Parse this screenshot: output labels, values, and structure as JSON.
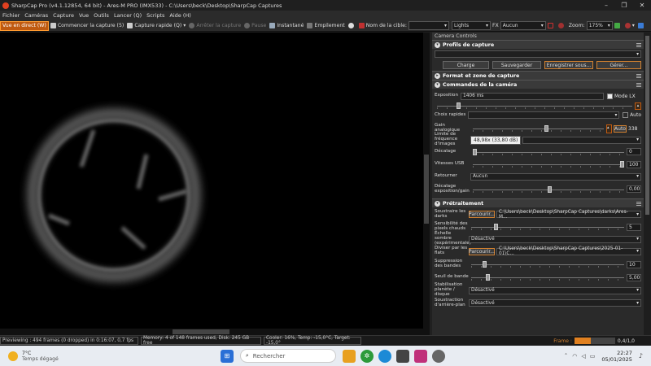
{
  "window": {
    "title": "SharpCap Pro (v4.1.12854, 64 bit) - Ares-M PRO (IMX533) - C:\\Users\\beck\\Desktop\\SharpCap Captures"
  },
  "menu": [
    "Fichier",
    "Caméras",
    "Capture",
    "Vue",
    "Outils",
    "Lancer (Q)",
    "Scripts",
    "Aide (H)"
  ],
  "toolbar": {
    "live": "Vue en direct (W)",
    "start": "Commencer la capture (5)",
    "quick": "Capture rapide (Q)",
    "stop": "Arrêter la capture",
    "pause": "Pause",
    "snapshot": "Instantané",
    "stack": "Empilement",
    "target_label": "Nom de la cible:",
    "target_value": "",
    "frame_type": "Lights",
    "fx_label": "FX",
    "fx_value": "Aucun",
    "zoom_label": "Zoom:",
    "zoom_value": "175%"
  },
  "panel": {
    "title": "Camera Controls",
    "profiles": {
      "header": "Profils de capture",
      "load": "Charge",
      "save": "Sauvegarder",
      "save_as": "Enregistrer sous...",
      "manage": "Gérer..."
    },
    "format": {
      "header": "Format et zone de capture"
    },
    "camera": {
      "header": "Commandes de la caméra",
      "exposure_label": "Exposition",
      "exposure_value": "1406 ms",
      "lx_label": "Mode LX",
      "quick_label": "Choix rapides",
      "auto_label": "Auto",
      "gain_label": "Gain analogique",
      "gain_auto": "Auto",
      "gain_value": "338",
      "tooltip": "48,98x (33,80 dB)",
      "framerate_label": "Limite de fréquence d'images",
      "offset_label": "Décalage",
      "offset_value": "0",
      "usb_label": "Vitesses USB",
      "usb_value": "100",
      "flip_label": "Retourner",
      "flip_value": "Aucun",
      "expgain_label": "Décalage exposition/gain",
      "expgain_value": "0,00"
    },
    "pre": {
      "header": "Prétraitement",
      "darks_label": "Soustraire les darks",
      "browse": "Parcourir...",
      "darks_path": "C:\\Users\\beck\\Desktop\\SharpCap Captures\\darks\\Ares-M...",
      "hot_label": "Sensibilité des pixels chauds",
      "hot_value": "5",
      "dark_scale_label": "Échelle sombre (expérimentale)",
      "dark_scale_value": "Désactivé",
      "flats_label": "Diviser par les flats",
      "flats_path": "C:\\Users\\beck\\Desktop\\SharpCap Captures\\2025-01-01\\C...",
      "banding_label": "Suppression des bandes",
      "banding_value": "10",
      "threshold_label": "Seuil de bande",
      "threshold_value": "5,00",
      "stab_label": "Stabilisation planète / disque",
      "stab_value": "Désactivé",
      "bg_label": "Soustraction d'arrière-plan",
      "bg_value": "Désactivé"
    }
  },
  "status": {
    "preview": "Previewing : 494 frames (0 dropped) in 0:16:07, 0,7 fps",
    "memory": "Memory: 4 of 148 frames used, Disk: 245 GB free",
    "cooler": "Cooler: 16%, Temp: -15,0°C, Target: -15,0°",
    "frame_label": "Frame :",
    "frame_value": "0,4/1,0",
    "frame_progress": 0.4
  },
  "taskbar": {
    "temp": "7°C",
    "weather": "Temps dégagé",
    "search": "Rechercher",
    "time": "22:27",
    "date": "05/01/2025"
  },
  "colors": {
    "accent": "#c05a10",
    "panel_bg": "#2a2a2a"
  }
}
